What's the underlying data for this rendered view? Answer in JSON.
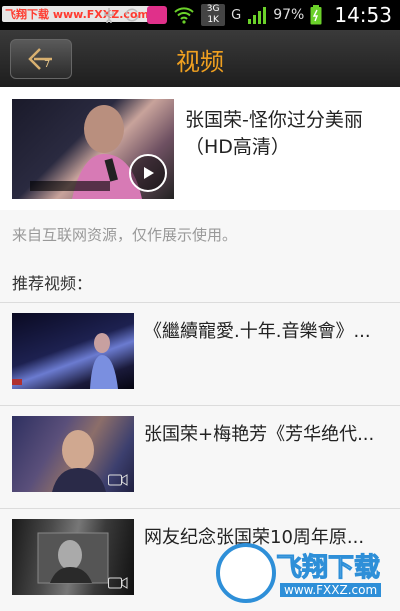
{
  "status_bar": {
    "watermark_text": "飞翔下载 www.FXXZ.com",
    "network_3g": "3G",
    "network_label": "G",
    "battery_percent": "97%",
    "time": "14:53"
  },
  "header": {
    "title": "视频"
  },
  "main_video": {
    "title": "张国荣-怪你过分美丽（HD高清）"
  },
  "source_note": "来自互联网资源，仅作展示使用。",
  "recommended_heading": "推荐视频：",
  "recommended": [
    {
      "title": "《繼續寵愛.十年.音樂會》..."
    },
    {
      "title": "张国荣+梅艳芳《芳华绝代..."
    },
    {
      "title": "网友纪念张国荣10周年原..."
    }
  ],
  "watermark": {
    "brand": "飞翔下载",
    "url": "www.FXXZ.com"
  },
  "colors": {
    "accent": "#f0a020",
    "header_bg": "#2a2a2a"
  }
}
